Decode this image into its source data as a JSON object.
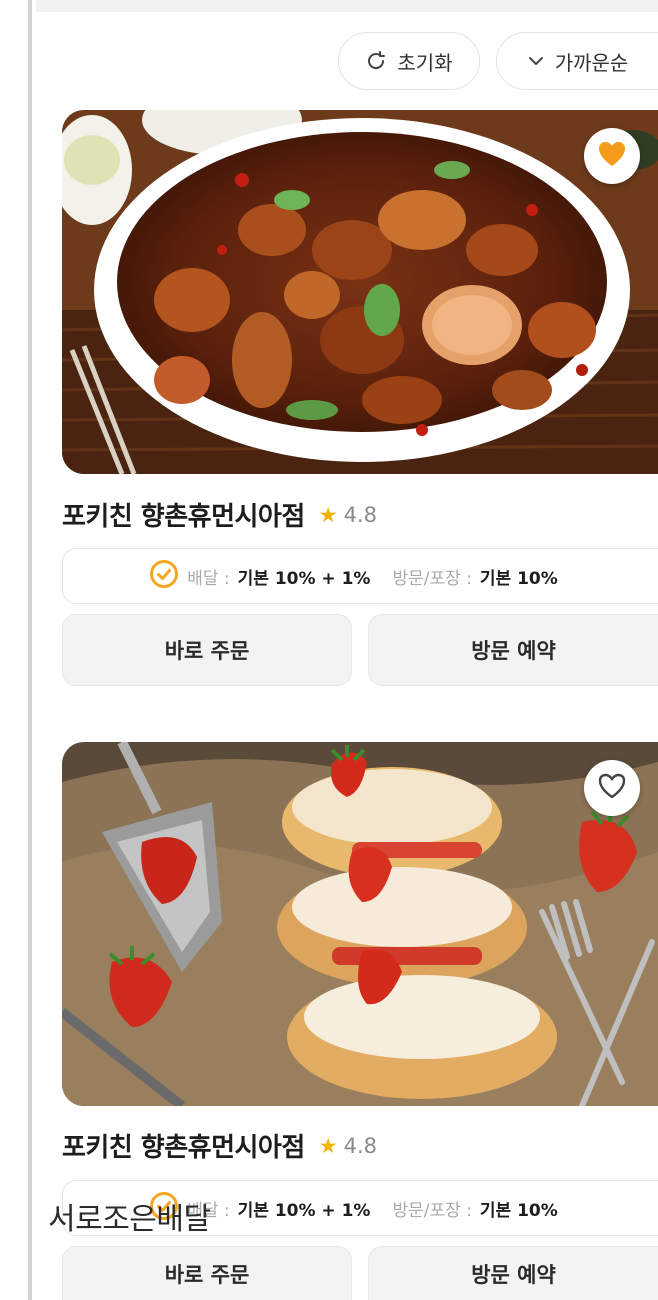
{
  "filters": {
    "reset_label": "초기화",
    "sort_label": "가까운순"
  },
  "stores": [
    {
      "name": "포키친 향촌휴먼시아점",
      "rating": "4.8",
      "favorited": true,
      "photo_icon": "braised-chicken-photo",
      "fees": {
        "delivery_label": "배달 :",
        "delivery_value": "기본 10% + 1%",
        "visit_label": "방문/포장 :",
        "visit_value": "기본 10%"
      },
      "order_label": "바로 주문",
      "visit_label": "방문 예약"
    },
    {
      "name": "포키친 향촌휴먼시아점",
      "rating": "4.8",
      "favorited": false,
      "photo_icon": "strawberry-cream-puff-photo",
      "fees": {
        "delivery_label": "배달 :",
        "delivery_value": "기본 10% + 1%",
        "visit_label": "방문/포장 :",
        "visit_value": "기본 10%"
      },
      "order_label": "바로 주문",
      "visit_label": "방문 예약"
    }
  ],
  "watermark": "서로조은배달",
  "colors": {
    "accent": "#f5a623",
    "star": "#f0b400",
    "heart_filled": "#f59b1c"
  }
}
